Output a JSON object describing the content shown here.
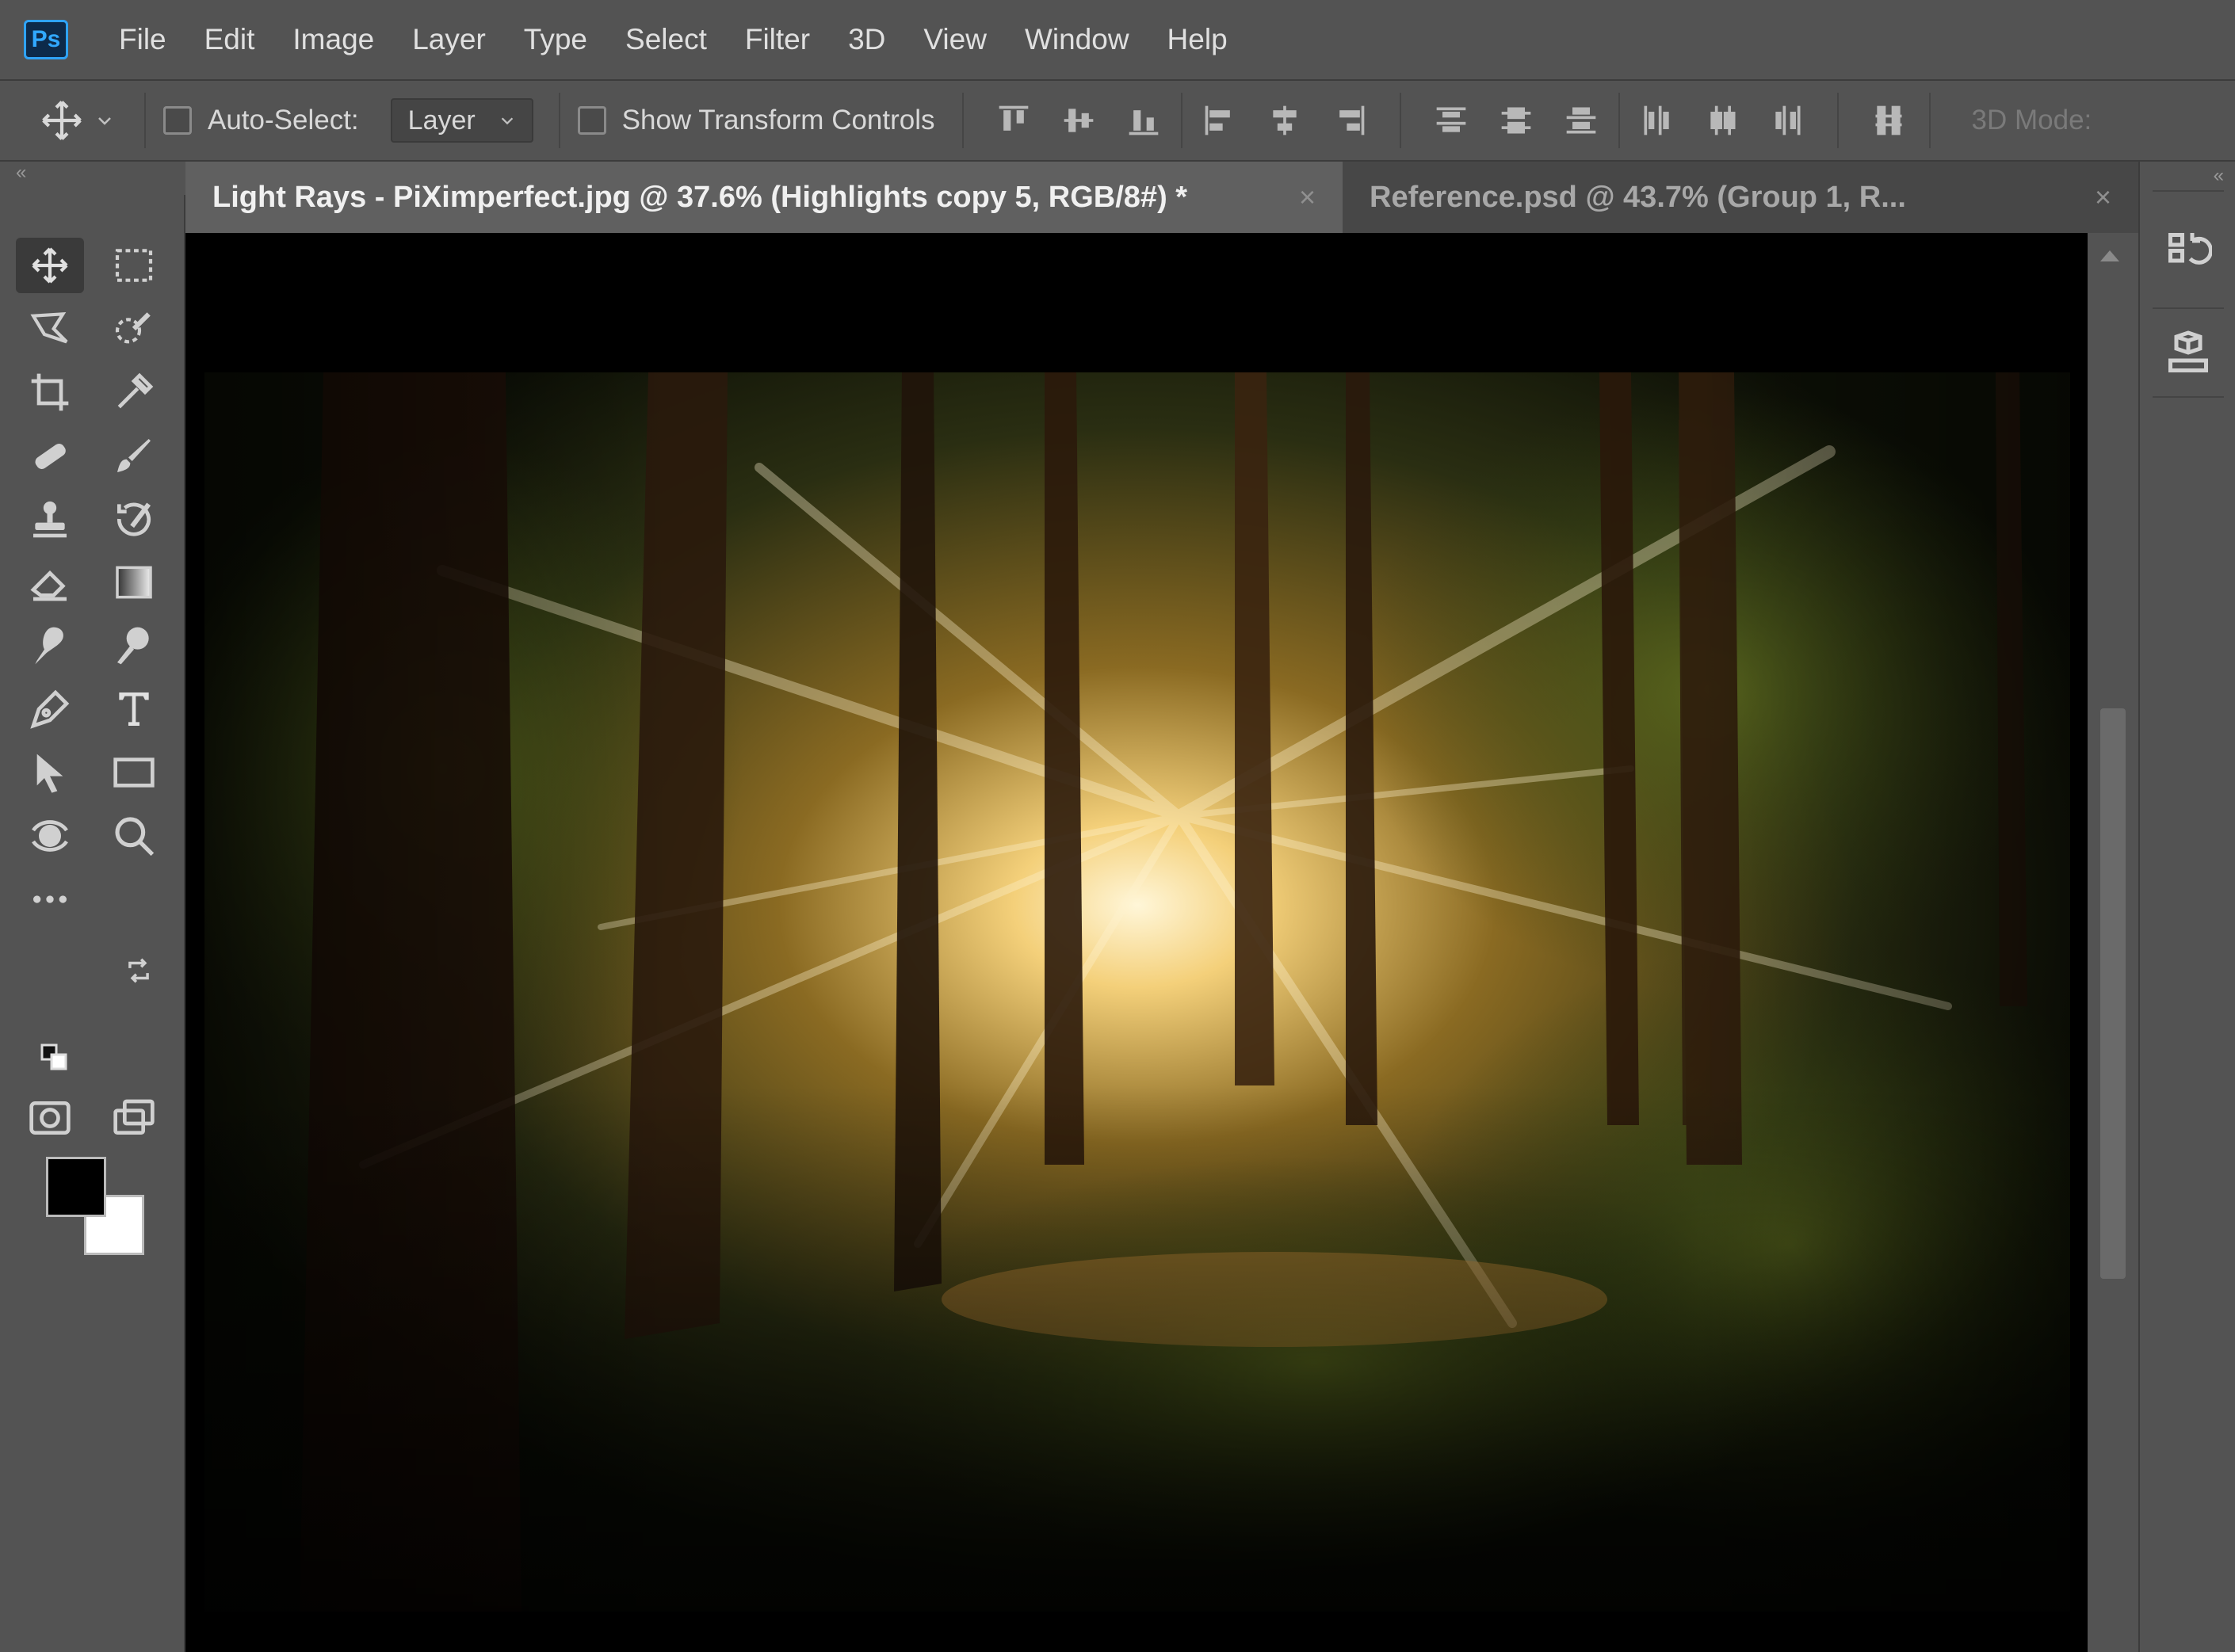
{
  "app": {
    "logo_text": "Ps"
  },
  "menu": [
    "File",
    "Edit",
    "Image",
    "Layer",
    "Type",
    "Select",
    "Filter",
    "3D",
    "View",
    "Window",
    "Help"
  ],
  "options": {
    "auto_select_label": "Auto-Select:",
    "auto_select_checked": false,
    "auto_select_target": "Layer",
    "show_transform_label": "Show Transform Controls",
    "show_transform_checked": false,
    "mode_3d_label": "3D Mode:"
  },
  "panels": {
    "collapse_glyph": "«"
  },
  "tabs": [
    {
      "title": "Light Rays - PiXimperfect.jpg @ 37.6% (Highlights copy 5, RGB/8#) *",
      "active": true,
      "close": "×"
    },
    {
      "title": "Reference.psd @ 43.7% (Group 1, R...",
      "active": false,
      "close": "×"
    }
  ],
  "tools": [
    {
      "name": "move-tool-icon",
      "active": true
    },
    {
      "name": "rectangular-marquee-tool-icon"
    },
    {
      "name": "polygonal-lasso-tool-icon"
    },
    {
      "name": "quick-selection-tool-icon"
    },
    {
      "name": "crop-tool-icon"
    },
    {
      "name": "eyedropper-tool-icon"
    },
    {
      "name": "healing-brush-tool-icon"
    },
    {
      "name": "brush-tool-icon"
    },
    {
      "name": "clone-stamp-tool-icon"
    },
    {
      "name": "history-brush-tool-icon"
    },
    {
      "name": "eraser-tool-icon"
    },
    {
      "name": "gradient-tool-icon"
    },
    {
      "name": "smudge-tool-icon"
    },
    {
      "name": "dodge-tool-icon"
    },
    {
      "name": "pen-tool-icon"
    },
    {
      "name": "type-tool-icon"
    },
    {
      "name": "path-selection-tool-icon"
    },
    {
      "name": "rectangle-tool-icon"
    },
    {
      "name": "3d-rotate-tool-icon"
    },
    {
      "name": "zoom-tool-icon"
    },
    {
      "name": "edit-toolbar-icon"
    }
  ],
  "colors": {
    "foreground": "#000000",
    "background": "#ffffff",
    "ui_bg": "#535353",
    "ps_blue": "#31a8ff"
  }
}
